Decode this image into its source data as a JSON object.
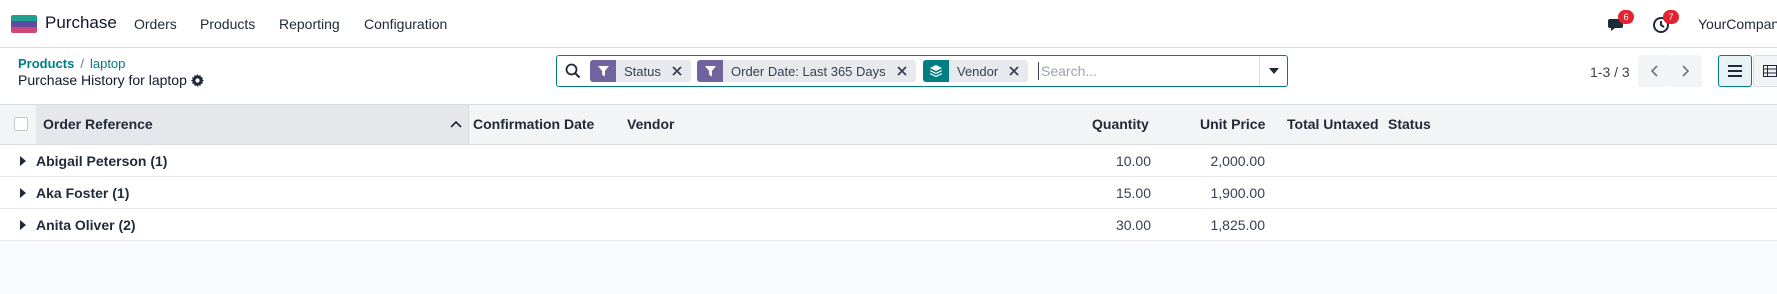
{
  "app": {
    "name": "Purchase",
    "menu": [
      "Orders",
      "Products",
      "Reporting",
      "Configuration"
    ],
    "company": "YourCompany",
    "messages_badge": "6",
    "activities_badge": "7"
  },
  "breadcrumb": {
    "items": [
      "Products",
      "laptop"
    ],
    "title": "Purchase History for laptop"
  },
  "search": {
    "facets": [
      {
        "type": "filter",
        "label": "Status"
      },
      {
        "type": "filter",
        "label": "Order Date: Last 365 Days"
      },
      {
        "type": "group",
        "label": "Vendor"
      }
    ],
    "placeholder": "Search..."
  },
  "pager": {
    "value": "1-3 / 3"
  },
  "table": {
    "columns": [
      "Order Reference",
      "Confirmation Date",
      "Vendor",
      "Quantity",
      "Unit Price",
      "Total Untaxed",
      "Status"
    ],
    "groups": [
      {
        "name": "Abigail Peterson (1)",
        "quantity": "10.00",
        "unit_price": "2,000.00"
      },
      {
        "name": "Aka Foster (1)",
        "quantity": "15.00",
        "unit_price": "1,900.00"
      },
      {
        "name": "Anita Oliver (2)",
        "quantity": "30.00",
        "unit_price": "1,825.00"
      }
    ]
  },
  "colors": {
    "accent": "#017e84",
    "filter_facet": "#71639e",
    "badge": "#e3242f"
  }
}
